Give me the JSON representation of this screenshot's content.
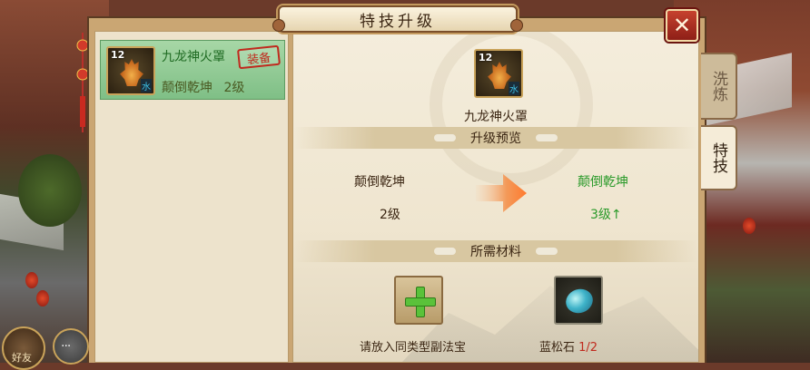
{
  "window": {
    "title": "特技升级",
    "close_label": "✕"
  },
  "side_tabs": [
    {
      "label": "洗炼",
      "active": false
    },
    {
      "label": "特技",
      "active": true
    }
  ],
  "equipment_list": [
    {
      "level": "12",
      "element": "水",
      "name": "九龙神火罩",
      "skill": "颠倒乾坤",
      "skill_level": "2级",
      "badge": "装备",
      "selected": true
    }
  ],
  "selected_item": {
    "level": "12",
    "element": "水",
    "name": "九龙神火罩"
  },
  "preview": {
    "heading": "升级预览",
    "current": {
      "skill": "颠倒乾坤",
      "level": "2级"
    },
    "next": {
      "skill": "颠倒乾坤",
      "level": "3级↑"
    }
  },
  "materials": {
    "heading": "所需材料",
    "slots": [
      {
        "label": "请放入同类型副法宝",
        "icon": "plus-icon"
      },
      {
        "label": "蓝松石",
        "count": "1/2",
        "icon": "turquoise-stone-icon"
      }
    ]
  },
  "hud": {
    "friend_label": "好友",
    "chat_label": "···"
  },
  "colors": {
    "green_text": "#2a9a2a",
    "red_stamp": "#c02a1e",
    "close_red": "#b3322a"
  }
}
